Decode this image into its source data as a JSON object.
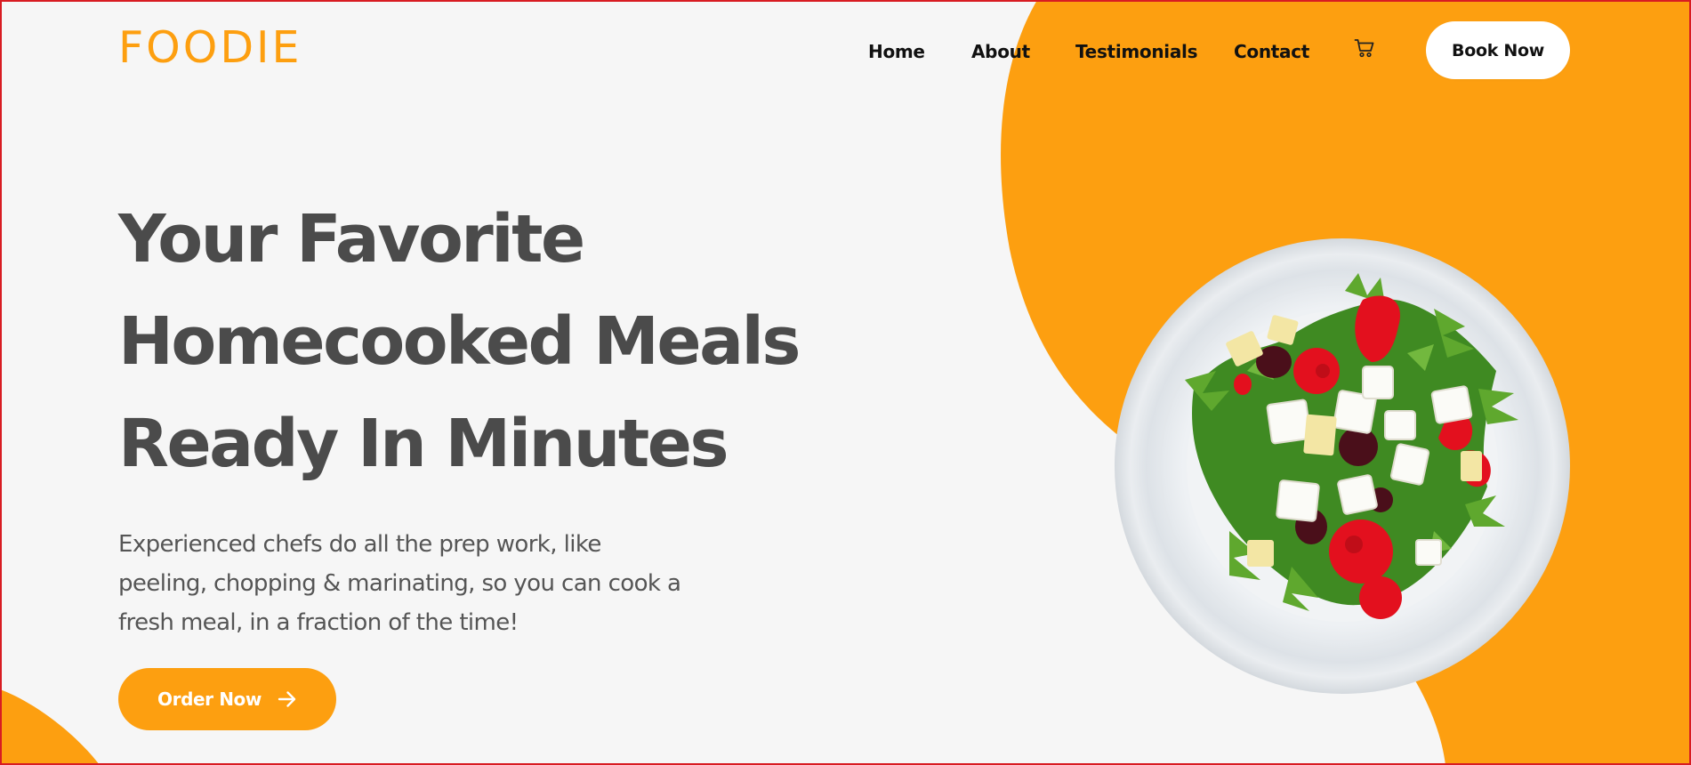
{
  "brand": {
    "logo": "FOODIE",
    "accent_color": "#fd9f10"
  },
  "nav": {
    "items": [
      {
        "label": "Home"
      },
      {
        "label": "About"
      },
      {
        "label": "Testimonials"
      },
      {
        "label": "Contact"
      }
    ],
    "cart_icon": "cart-icon",
    "book_label": "Book Now"
  },
  "hero": {
    "headline_lines": [
      "Your Favorite",
      "Homecooked Meals",
      "Ready In Minutes"
    ],
    "subtext": "Experienced chefs do all the prep work, like peeling, chopping & marinating, so you can cook a fresh meal, in a fraction of the time!",
    "cta_label": "Order Now",
    "cta_icon": "arrow-right-icon",
    "image": "salad-plate"
  },
  "colors": {
    "background": "#f6f6f6",
    "text_dark": "#4b4b4b",
    "button_white": "#ffffff"
  }
}
